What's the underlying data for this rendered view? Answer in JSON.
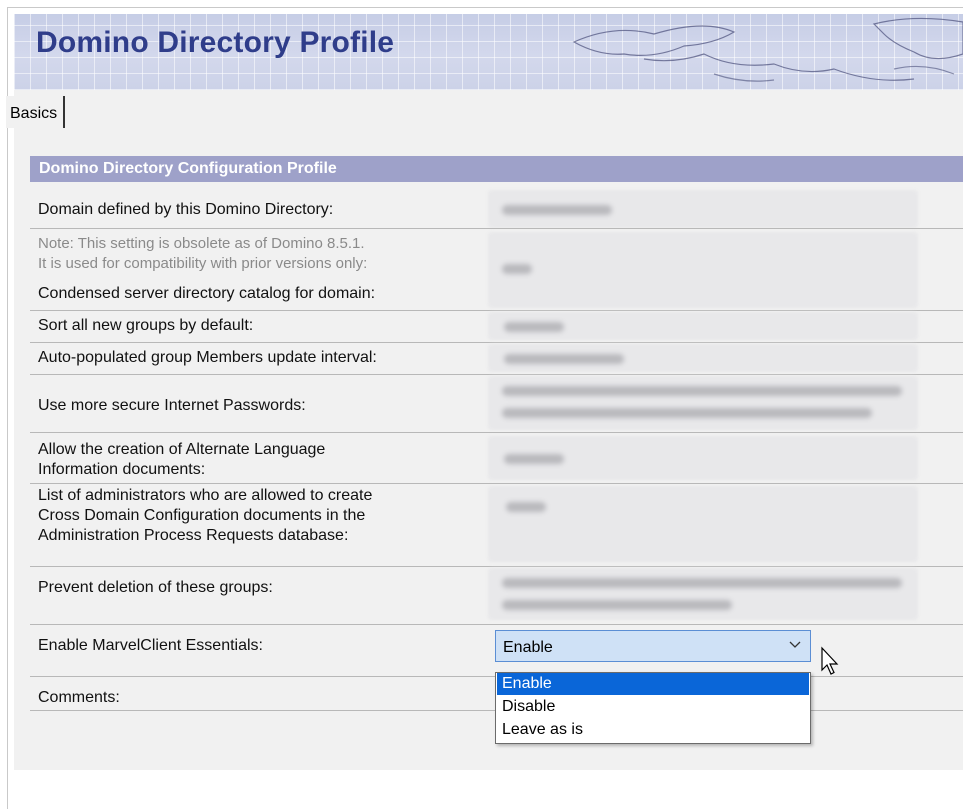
{
  "header": {
    "title": "Domino Directory Profile"
  },
  "tabs": [
    {
      "label": "Basics"
    }
  ],
  "section": {
    "title": "Domino Directory Configuration Profile"
  },
  "fields": [
    {
      "label": "Domain defined by this Domino Directory:"
    },
    {
      "note_line1": "Note: This setting is obsolete as of Domino 8.5.1.",
      "note_line2": "It is used for compatibility with prior versions only:",
      "label": "Condensed server directory catalog for domain:"
    },
    {
      "label": "Sort all new groups by default:"
    },
    {
      "label": "Auto-populated group Members update interval:"
    },
    {
      "label": "Use more secure Internet Passwords:"
    },
    {
      "label_line1": "Allow the creation of Alternate Language",
      "label_line2": "Information documents:"
    },
    {
      "label_line1": "List of administrators who are allowed to create",
      "label_line2": "Cross Domain Configuration documents in the",
      "label_line3": "Administration Process Requests database:"
    },
    {
      "label": "Prevent deletion of these groups:"
    },
    {
      "label": "Enable MarvelClient Essentials:"
    },
    {
      "label": "Comments:"
    }
  ],
  "marvelclient_select": {
    "value": "Enable",
    "options": [
      "Enable",
      "Disable",
      "Leave as is"
    ],
    "highlighted_index": 0
  },
  "colors": {
    "header_title": "#2f3d8a",
    "section_header_bg": "#9ea1c9",
    "selection_highlight": "#0a66d8",
    "select_bg": "#cfe1f6"
  }
}
